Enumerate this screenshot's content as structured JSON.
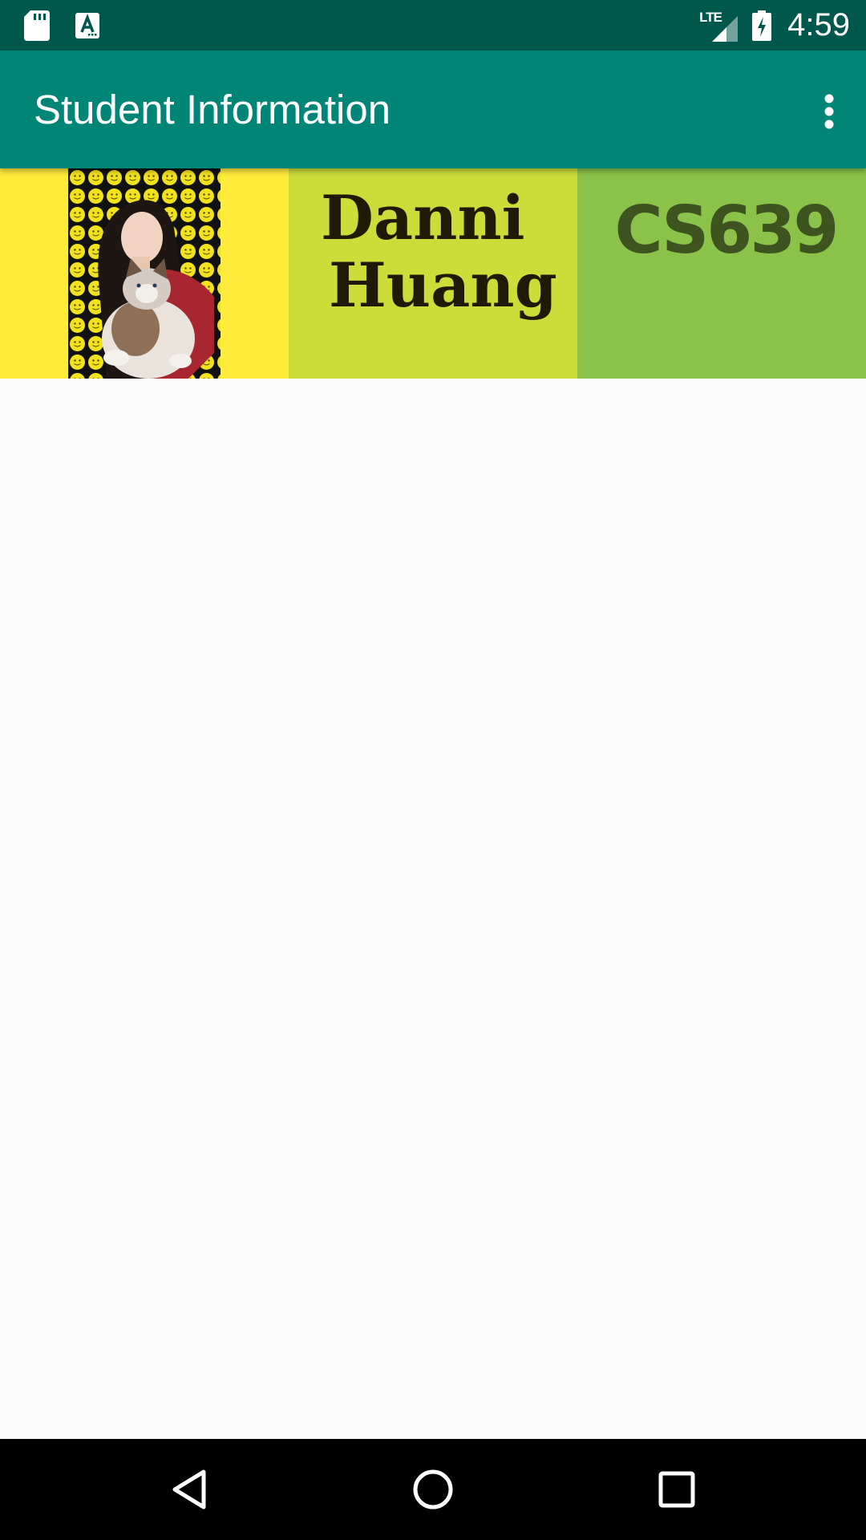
{
  "status_bar": {
    "time": "4:59",
    "network_label": "LTE",
    "icons": [
      "sd-card-icon",
      "font-download-icon",
      "lte-signal-icon",
      "battery-charging-icon"
    ],
    "background": "#00574B"
  },
  "app_bar": {
    "title": "Student Information",
    "overflow_icon": "more-vert-icon",
    "background": "#008577"
  },
  "student": {
    "photo_icon": "student-photo",
    "first_name": "Danni",
    "last_name": "Huang",
    "course": "CS639"
  },
  "colors": {
    "photo_cell": "#FFEB3B",
    "name_cell": "#CDDC39",
    "course_cell": "#8BC34A",
    "page_background": "#FAFAFA"
  },
  "nav_bar": {
    "buttons": [
      "back-icon",
      "home-icon",
      "recents-icon"
    ]
  }
}
